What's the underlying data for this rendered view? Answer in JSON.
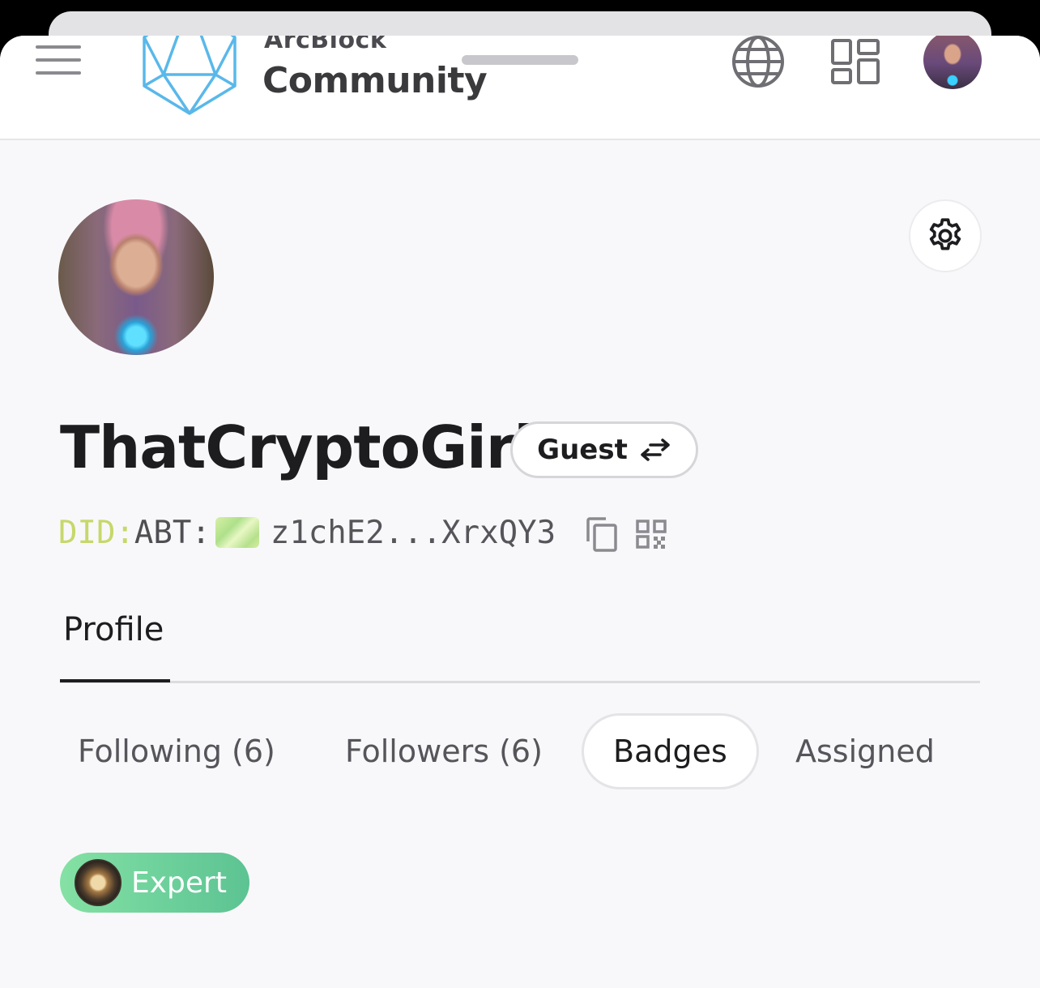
{
  "header": {
    "brand_top": "ArcBlock",
    "brand_main": "Community",
    "menu_icon": "hamburger-menu-icon",
    "language_icon": "globe-icon",
    "apps_icon": "dashboard-grid-icon",
    "avatar_icon": "user-avatar"
  },
  "profile": {
    "username": "ThatCryptoGirl",
    "role": "Guest",
    "role_icon": "switch-arrows-icon",
    "did_prefix": "DID:",
    "did_scheme": "ABT:",
    "did_value": "z1chE2...XrxQY3",
    "settings_icon": "gear-icon"
  },
  "tabs": [
    {
      "label": "Profile",
      "active": true
    }
  ],
  "sub_tabs": [
    {
      "label": "Following (6)"
    },
    {
      "label": "Followers (6)"
    },
    {
      "label": "Badges",
      "selected": true
    },
    {
      "label": "Assigned"
    }
  ],
  "badges": [
    {
      "label": "Expert",
      "color": "#6fd29c"
    }
  ],
  "colors": {
    "background": "#f8f8fa",
    "text_primary": "#1d1d1f",
    "did_prefix": "#c6d86b",
    "badge_green": "#6fd29c"
  }
}
